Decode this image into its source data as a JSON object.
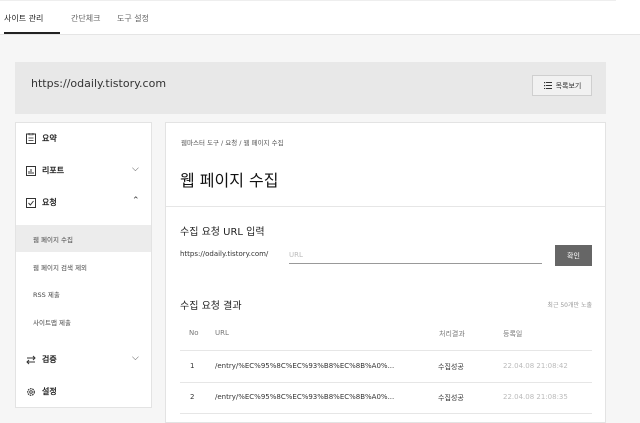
{
  "tabs": [
    {
      "label": "사이트 관리",
      "active": true
    },
    {
      "label": "간단체크",
      "active": false
    },
    {
      "label": "도구 설정",
      "active": false
    }
  ],
  "site": {
    "url": "https://odaily.tistory.com",
    "list_button": "목록보기"
  },
  "sidebar": {
    "items": [
      {
        "label": "요약",
        "icon": "document-icon"
      },
      {
        "label": "리포트",
        "icon": "chart-icon"
      },
      {
        "label": "요청",
        "icon": "checkbox-icon"
      },
      {
        "label": "검증",
        "icon": "transfer-icon"
      },
      {
        "label": "설정",
        "icon": "gear-icon"
      }
    ],
    "sub_items": [
      {
        "label": "웹 페이지 수집",
        "active": true
      },
      {
        "label": "웹 페이지 검색 제외",
        "active": false
      },
      {
        "label": "RSS 제출",
        "active": false
      },
      {
        "label": "사이트맵 제출",
        "active": false
      }
    ]
  },
  "main": {
    "breadcrumb": "웹마스터 도구  /  요청  /  웹 페이지 수집",
    "title": "웹 페이지 수집",
    "request_section": {
      "title": "수집 요청 URL 입력",
      "prefix": "https://odaily.tistory.com/",
      "placeholder": "URL",
      "button": "확인"
    },
    "results_section": {
      "title": "수집 요청 결과",
      "note": "최근 50개만 노출",
      "columns": [
        "No",
        "URL",
        "처리결과",
        "등록일"
      ],
      "rows": [
        {
          "no": "1",
          "url": "/entry/%EC%95%8C%EC%93%B8%EC%8B%A0%...",
          "result": "수집성공",
          "date": "22.04.08 21:08:42"
        },
        {
          "no": "2",
          "url": "/entry/%EC%95%8C%EC%93%B8%EC%8B%A0%...",
          "result": "수집성공",
          "date": "22.04.08 21:08:35"
        }
      ]
    }
  }
}
